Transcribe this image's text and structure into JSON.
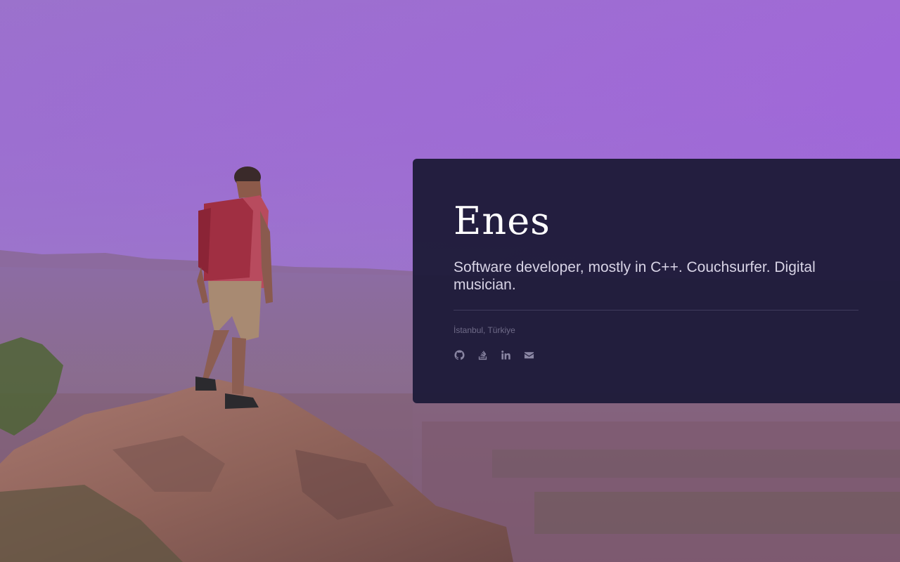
{
  "profile": {
    "name": "Enes",
    "tagline": "Software developer, mostly in C++. Couchsurfer. Digital musician.",
    "location": "İstanbul, Türkiye"
  },
  "socials": [
    {
      "icon": "github-icon"
    },
    {
      "icon": "stackoverflow-icon"
    },
    {
      "icon": "linkedin-icon"
    },
    {
      "icon": "email-icon"
    }
  ],
  "colors": {
    "overlay": "#a55ae8",
    "card": "#1f1c3a",
    "icon": "#8a86a3"
  }
}
